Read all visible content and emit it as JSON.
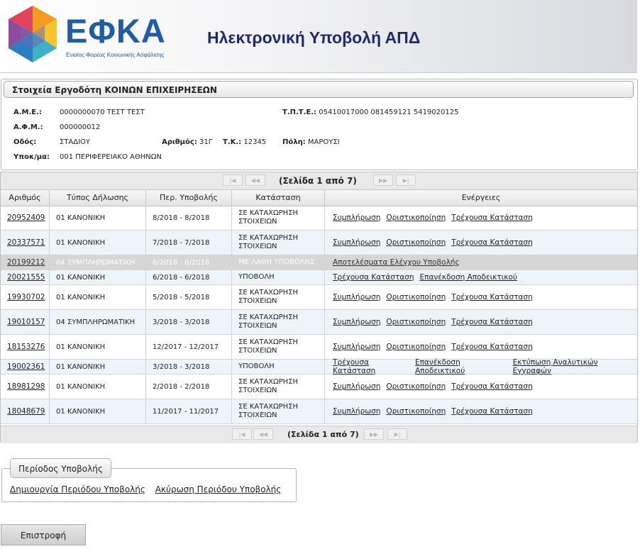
{
  "header": {
    "logo_text": "ΕΦΚΑ",
    "logo_subtitle": "Ενιαίος Φορέας Κοινωνικής Ασφάλισης",
    "title": "Ηλεκτρονική Υποβολή ΑΠΔ"
  },
  "employer": {
    "legend": "Στοιχεία Εργοδότη ΚΟΙΝΩΝ ΕΠΙΧΕΙΡΗΣΕΩΝ",
    "ame_label": "Α.Μ.Ε.:",
    "ame_value": "0000000070 ΤΕΣΤ ΤΕΣΤ",
    "tpte_label": "Τ.Π.Τ.Ε.:",
    "tpte_value": "05410017000 081459121 5419020125",
    "afm_label": "Α.Φ.Μ.:",
    "afm_value": "000000012",
    "street_label": "Οδός:",
    "street_value": "ΣΤΑΔΙΟΥ",
    "number_label": "Αριθμός:",
    "number_value": "31Γ",
    "tk_label": "Τ.Κ.:",
    "tk_value": "12345",
    "city_label": "Πόλη:",
    "city_value": "ΜΑΡΟΥΣΙ",
    "branch_label": "Υποκ/μα:",
    "branch_value": "001 ΠΕΡΙΦΕΡΕΙΑΚΟ ΑΘΗΝΩΝ"
  },
  "pager": {
    "top_text": "(Σελίδα 1 από 7)",
    "bottom_text": "(Σελίδα 1 από 7)",
    "first_icon": "first-page-icon",
    "prev_icon": "prev-page-icon",
    "next_icon": "next-page-icon",
    "last_icon": "last-page-icon"
  },
  "table": {
    "columns": [
      "Αριθμός",
      "Τύπος Δήλωσης",
      "Περ. Υποβολής",
      "Κατάσταση",
      "Ενέργειες"
    ],
    "rows": [
      {
        "id": "20952409",
        "type": "01 ΚΑΝΟΝΙΚΗ",
        "period": "8/2018 - 8/2018",
        "status": "ΣΕ ΚΑΤΑΧΩΡΗΣΗ ΣΤΟΙΧΕΙΩΝ",
        "actions": [
          "Συμπλήρωση",
          "Οριστικοποίηση",
          "Τρέχουσα Κατάσταση"
        ]
      },
      {
        "id": "20337571",
        "type": "01 ΚΑΝΟΝΙΚΗ",
        "period": "7/2018 - 7/2018",
        "status": "ΣΕ ΚΑΤΑΧΩΡΗΣΗ ΣΤΟΙΧΕΙΩΝ",
        "actions": [
          "Συμπλήρωση",
          "Οριστικοποίηση",
          "Τρέχουσα Κατάσταση"
        ]
      },
      {
        "id": "20199212",
        "type": "04 ΣΥΜΠΛΗΡΩΜΑΤΙΚΗ",
        "period": "6/2018 - 6/2018",
        "status": "ΜΕ ΛΑΘΗ ΥΠΟΒΟΛΗΣ",
        "actions": [
          "Αποτελέσματα Ελέγχου Υποβολής"
        ]
      },
      {
        "id": "20021555",
        "type": "01 ΚΑΝΟΝΙΚΗ",
        "period": "6/2018 - 6/2018",
        "status": "ΥΠΟΒΟΛΗ",
        "actions": [
          "Τρέχουσα Κατάσταση",
          "Επανέκδοση Αποδεικτικού"
        ]
      },
      {
        "id": "19930702",
        "type": "01 ΚΑΝΟΝΙΚΗ",
        "period": "5/2018 - 5/2018",
        "status": "ΣΕ ΚΑΤΑΧΩΡΗΣΗ ΣΤΟΙΧΕΙΩΝ",
        "actions": [
          "Συμπλήρωση",
          "Οριστικοποίηση",
          "Τρέχουσα Κατάσταση"
        ]
      },
      {
        "id": "19010157",
        "type": "04 ΣΥΜΠΛΗΡΩΜΑΤΙΚΗ",
        "period": "3/2018 - 3/2018",
        "status": "ΣΕ ΚΑΤΑΧΩΡΗΣΗ ΣΤΟΙΧΕΙΩΝ",
        "actions": [
          "Συμπλήρωση",
          "Οριστικοποίηση",
          "Τρέχουσα Κατάσταση"
        ]
      },
      {
        "id": "18153276",
        "type": "01 ΚΑΝΟΝΙΚΗ",
        "period": "12/2017 - 12/2017",
        "status": "ΣΕ ΚΑΤΑΧΩΡΗΣΗ ΣΤΟΙΧΕΙΩΝ",
        "actions": [
          "Συμπλήρωση",
          "Οριστικοποίηση",
          "Τρέχουσα Κατάσταση"
        ]
      },
      {
        "id": "19002361",
        "type": "01 ΚΑΝΟΝΙΚΗ",
        "period": "3/2018 - 3/2018",
        "status": "ΥΠΟΒΟΛΗ",
        "actions": [
          "Τρέχουσα Κατάσταση",
          "Επανέκδοση Αποδεικτικού",
          "Εκτύπωση Αναλυτικών Εγγραφών"
        ]
      },
      {
        "id": "18981298",
        "type": "01 ΚΑΝΟΝΙΚΗ",
        "period": "2/2018 - 2/2018",
        "status": "ΣΕ ΚΑΤΑΧΩΡΗΣΗ ΣΤΟΙΧΕΙΩΝ",
        "actions": [
          "Συμπλήρωση",
          "Οριστικοποίηση",
          "Τρέχουσα Κατάσταση"
        ]
      },
      {
        "id": "18048679",
        "type": "01 ΚΑΝΟΝΙΚΗ",
        "period": "11/2017 - 11/2017",
        "status": "ΣΕ ΚΑΤΑΧΩΡΗΣΗ ΣΤΟΙΧΕΙΩΝ",
        "actions": [
          "Συμπλήρωση",
          "Οριστικοποίηση",
          "Τρέχουσα Κατάσταση"
        ]
      }
    ]
  },
  "period_section": {
    "legend": "Περίοδος Υποβολής",
    "create_link": "Δημιουργία Περιόδου Υποβολής",
    "cancel_link": "Ακύρωση Περιόδου Υποβολής"
  },
  "back_button": "Επιστροφή",
  "colors": {
    "brand_blue": "#1f5ea7",
    "title_navy": "#1d2a6d",
    "alt_row": "#eef4fb",
    "error_row": "#d6d6d6"
  }
}
